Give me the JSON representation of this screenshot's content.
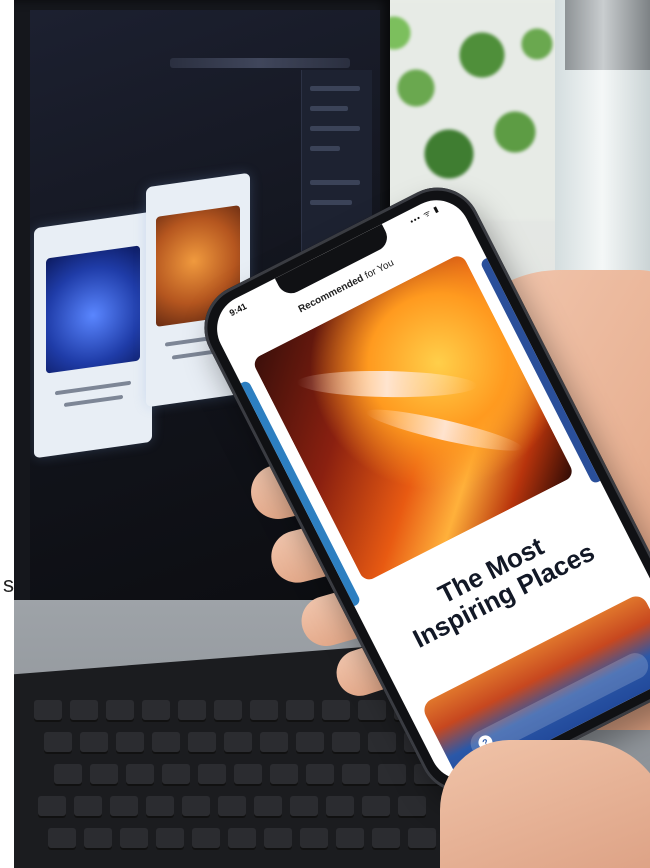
{
  "photo": {
    "subject": "phone-held-over-laptop",
    "margin_glyph": "s"
  },
  "phone_app": {
    "status_time": "9:41",
    "status_icons": "••• ᯤ ▮",
    "header_bold": "Recommended",
    "header_rest": "for You",
    "kicker": "",
    "title_line1": "The Most",
    "title_line2": "Inspiring Places",
    "subtitle": "",
    "cta_icon": "?",
    "cta_label": ""
  },
  "colors": {
    "title": "#121826",
    "subtitle": "#3d6fd0",
    "accent_blue": "#2b58a8",
    "hero_orange": "#ff9a1f"
  }
}
